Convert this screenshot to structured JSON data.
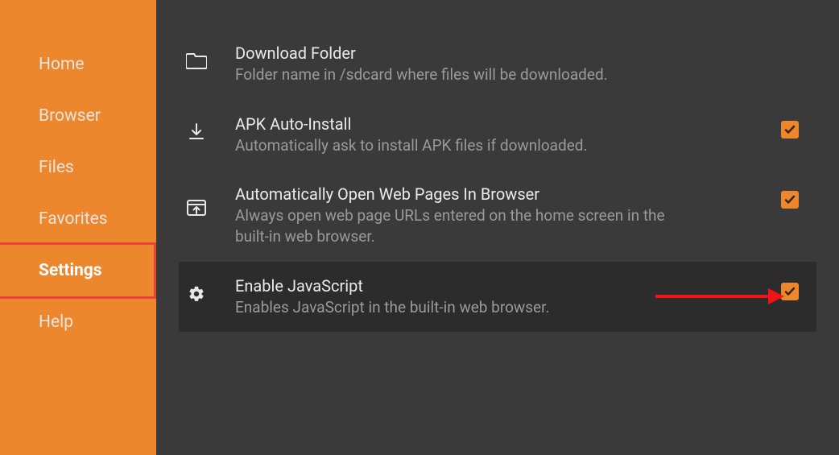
{
  "sidebar": {
    "items": [
      {
        "label": "Home"
      },
      {
        "label": "Browser"
      },
      {
        "label": "Files"
      },
      {
        "label": "Favorites"
      },
      {
        "label": "Settings"
      },
      {
        "label": "Help"
      }
    ]
  },
  "settings": [
    {
      "title": "Download Folder",
      "desc": "Folder name in /sdcard where files will be downloaded.",
      "icon": "folder-icon",
      "checkbox": null,
      "highlighted": false
    },
    {
      "title": "APK Auto-Install",
      "desc": "Automatically ask to install APK files if downloaded.",
      "icon": "download-icon",
      "checkbox": true,
      "highlighted": false
    },
    {
      "title": "Automatically Open Web Pages In Browser",
      "desc": "Always open web page URLs entered on the home screen in the built-in web browser.",
      "icon": "open-in-browser-icon",
      "checkbox": true,
      "highlighted": false
    },
    {
      "title": "Enable JavaScript",
      "desc": "Enables JavaScript in the built-in web browser.",
      "icon": "gear-icon",
      "checkbox": true,
      "highlighted": true
    }
  ],
  "colors": {
    "accent": "#ed872d",
    "highlight_border": "#e8423c",
    "arrow": "#f01414"
  }
}
